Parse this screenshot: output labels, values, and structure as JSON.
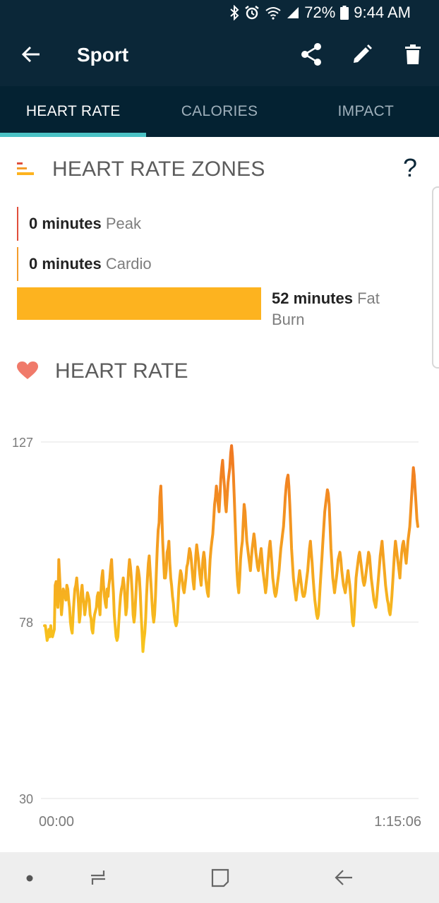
{
  "status_bar": {
    "battery_text": "72%",
    "time": "9:44 AM",
    "icons": [
      "bluetooth-icon",
      "alarm-icon",
      "wifi-icon",
      "signal-icon",
      "battery-icon"
    ]
  },
  "app_bar": {
    "title": "Sport",
    "icons": [
      "back-arrow-icon",
      "share-icon",
      "edit-pencil-icon",
      "trash-icon"
    ]
  },
  "tabs": [
    {
      "label": "HEART RATE",
      "active": true
    },
    {
      "label": "CALORIES",
      "active": false
    },
    {
      "label": "IMPACT",
      "active": false
    }
  ],
  "zones_section": {
    "title": "HEART RATE ZONES",
    "help_label": "?",
    "zones": [
      {
        "value": "0 minutes",
        "name": "Peak",
        "color": "#e04e3b"
      },
      {
        "value": "0 minutes",
        "name": "Cardio",
        "color": "#f39c2b"
      },
      {
        "value": "52 minutes",
        "name": "Fat Burn",
        "color": "#fdb31f"
      }
    ]
  },
  "heart_section": {
    "title": "HEART RATE"
  },
  "chart_data": {
    "type": "line",
    "y_ticks": [
      "127",
      "78",
      "30"
    ],
    "x_labels": [
      "00:00",
      "1:15:06"
    ],
    "ylim": [
      30,
      127
    ],
    "grid": true,
    "colors": {
      "low": "#f8c61e",
      "high": "#f07623"
    },
    "values": [
      77,
      77,
      75,
      73,
      74,
      76,
      74,
      77,
      75,
      74,
      75,
      76,
      88,
      89,
      84,
      82,
      95,
      90,
      85,
      80,
      83,
      87,
      86,
      85,
      84,
      88,
      87,
      84,
      82,
      78,
      76,
      75,
      80,
      84,
      87,
      88,
      90,
      87,
      83,
      78,
      80,
      86,
      88,
      85,
      83,
      80,
      82,
      84,
      86,
      85,
      84,
      80,
      79,
      76,
      75,
      78,
      80,
      81,
      82,
      85,
      86,
      83,
      80,
      86,
      90,
      92,
      88,
      85,
      83,
      82,
      87,
      85,
      88,
      90,
      93,
      95,
      90,
      86,
      80,
      77,
      74,
      73,
      74,
      78,
      82,
      85,
      87,
      88,
      90,
      88,
      84,
      80,
      82,
      88,
      92,
      95,
      93,
      90,
      86,
      80,
      78,
      80,
      85,
      90,
      93,
      92,
      90,
      86,
      80,
      75,
      70,
      73,
      75,
      79,
      85,
      90,
      94,
      96,
      92,
      88,
      84,
      80,
      78,
      80,
      85,
      92,
      98,
      103,
      105,
      112,
      115,
      108,
      100,
      95,
      90,
      90,
      92,
      97,
      98,
      100,
      94,
      90,
      88,
      85,
      83,
      80,
      78,
      77,
      78,
      82,
      87,
      90,
      92,
      91,
      89,
      87,
      86,
      88,
      90,
      93,
      94,
      96,
      98,
      97,
      95,
      92,
      89,
      87,
      91,
      96,
      99,
      97,
      95,
      92,
      90,
      88,
      92,
      95,
      97,
      95,
      90,
      88,
      86,
      85,
      90,
      95,
      98,
      100,
      102,
      106,
      110,
      112,
      115,
      113,
      110,
      108,
      112,
      117,
      120,
      122,
      118,
      115,
      110,
      108,
      112,
      116,
      118,
      120,
      124,
      126,
      123,
      118,
      112,
      105,
      98,
      92,
      88,
      86,
      90,
      95,
      98,
      100,
      105,
      110,
      108,
      104,
      100,
      98,
      96,
      94,
      92,
      95,
      98,
      100,
      102,
      100,
      97,
      95,
      93,
      92,
      94,
      96,
      98,
      95,
      92,
      90,
      88,
      86,
      88,
      92,
      95,
      98,
      100,
      97,
      94,
      90,
      88,
      86,
      85,
      86,
      88,
      90,
      92,
      95,
      98,
      100,
      102,
      104,
      108,
      112,
      115,
      117,
      118,
      115,
      110,
      104,
      98,
      94,
      90,
      88,
      86,
      84,
      86,
      88,
      90,
      92,
      90,
      88,
      86,
      85,
      85,
      86,
      88,
      90,
      92,
      95,
      98,
      100,
      97,
      94,
      90,
      87,
      84,
      82,
      80,
      79,
      80,
      84,
      88,
      92,
      96,
      100,
      104,
      108,
      110,
      112,
      114,
      113,
      110,
      104,
      98,
      94,
      90,
      88,
      86,
      88,
      90,
      92,
      95,
      96,
      97,
      95,
      92,
      90,
      88,
      87,
      86,
      88,
      90,
      92,
      90,
      88,
      85,
      82,
      78,
      77,
      80,
      85,
      90,
      92,
      94,
      96,
      97,
      95,
      93,
      91,
      89,
      88,
      89,
      91,
      93,
      95,
      97,
      96,
      93,
      90,
      88,
      86,
      84,
      83,
      82,
      84,
      87,
      90,
      93,
      96,
      98,
      100,
      97,
      94,
      91,
      88,
      86,
      84,
      83,
      81,
      80,
      82,
      85,
      89,
      93,
      97,
      100,
      98,
      96,
      94,
      92,
      90,
      94,
      97,
      99,
      100,
      98,
      96,
      94,
      97,
      100,
      102,
      104,
      108,
      112,
      116,
      120,
      118,
      114,
      110,
      106,
      104
    ]
  },
  "nav_bar": {
    "icons": [
      "dot-icon",
      "recent-apps-icon",
      "home-icon",
      "back-icon"
    ]
  }
}
